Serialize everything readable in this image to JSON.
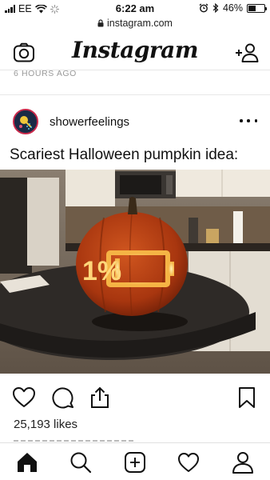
{
  "status_bar": {
    "carrier": "EE",
    "time": "6:22 am",
    "battery": "46%",
    "battery_level": 0.46
  },
  "browser": {
    "url": "instagram.com"
  },
  "header": {
    "logo": "Instagram",
    "left_icon": "camera-icon",
    "right_icon": "add-user-icon"
  },
  "previous_post": {
    "timestamp": "6 HOURS AGO"
  },
  "post": {
    "username": "showerfeelings",
    "title": "Scariest Halloween pumpkin idea:",
    "pumpkin_text": "1%",
    "likes": "25,193 likes",
    "actions": [
      "heart-icon",
      "comment-icon",
      "share-icon",
      "bookmark-icon"
    ]
  },
  "bottom_nav": {
    "items": [
      "home-icon",
      "search-icon",
      "new-post-icon",
      "activity-icon",
      "profile-icon"
    ]
  },
  "colors": {
    "text": "#111111",
    "muted": "#9a9a9a",
    "divider": "#e8e8e8",
    "pumpkin": "#c0421a"
  }
}
